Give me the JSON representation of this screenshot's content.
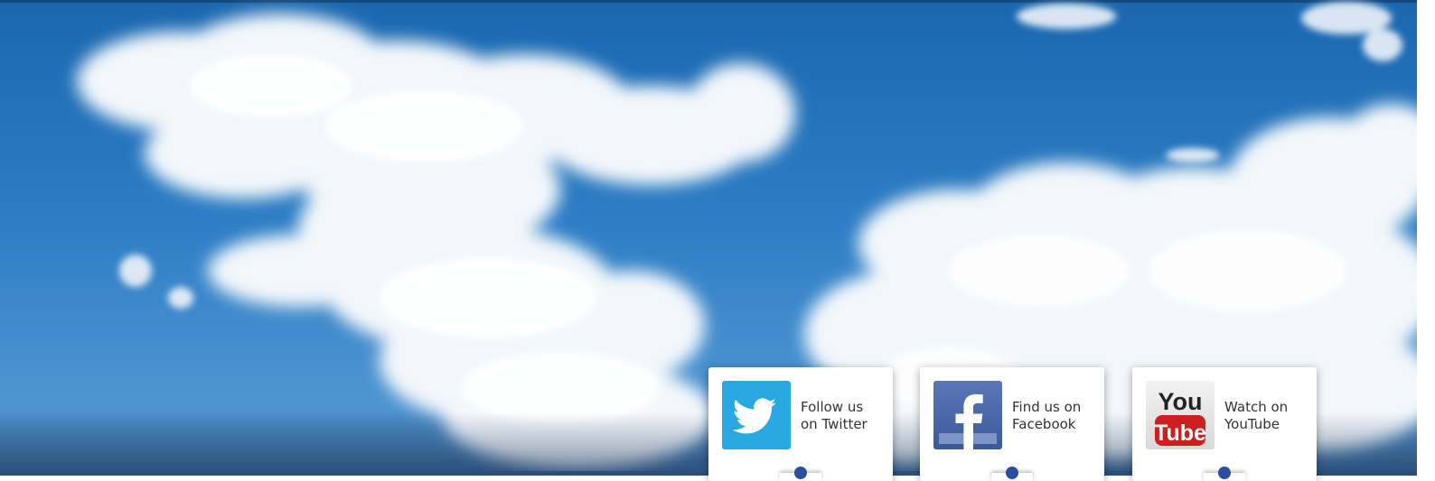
{
  "social": {
    "twitter": {
      "line1": "Follow us",
      "line2": "on Twitter",
      "icon": "twitter-bird-icon",
      "color": "#29a9e1"
    },
    "facebook": {
      "line1": "Find us on",
      "line2": "Facebook",
      "icon": "facebook-f-icon",
      "color": "#3b5998"
    },
    "youtube": {
      "line1": "Watch on",
      "line2": "YouTube",
      "icon": "youtube-logo-icon",
      "logo_top": "You",
      "logo_bottom": "Tube",
      "color": "#cc1f1f"
    }
  },
  "colors": {
    "sky": "#1a67b0",
    "nub_dot": "#2b4fa0"
  }
}
